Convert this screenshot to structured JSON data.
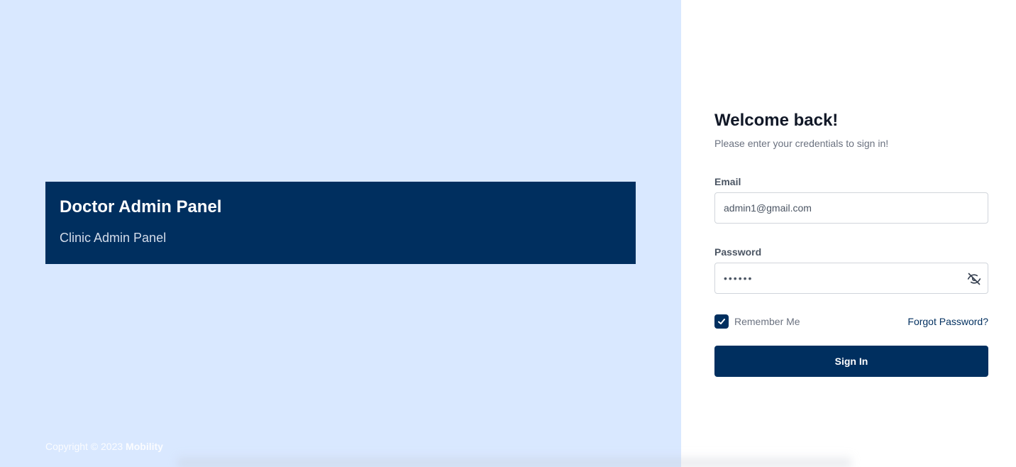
{
  "branding": {
    "title": "Doctor Admin Panel",
    "subtitle": "Clinic Admin Panel"
  },
  "footer": {
    "copyright_prefix": "Copyright © 2023",
    "brand_name": "Mobility"
  },
  "login": {
    "title": "Welcome back!",
    "subtitle": "Please enter your credentials to sign in!",
    "email": {
      "label": "Email",
      "value": "admin1@gmail.com"
    },
    "password": {
      "label": "Password",
      "value": "••••••"
    },
    "remember_me": {
      "label": "Remember Me",
      "checked": true
    },
    "forgot_password_label": "Forgot Password?",
    "submit_label": "Sign In"
  },
  "colors": {
    "left_background": "#d9e8ff",
    "brand_navy": "#002f5f",
    "right_background": "#ffffff"
  },
  "icons": {
    "password_toggle": "eye-off-icon",
    "checkbox": "check-icon"
  }
}
